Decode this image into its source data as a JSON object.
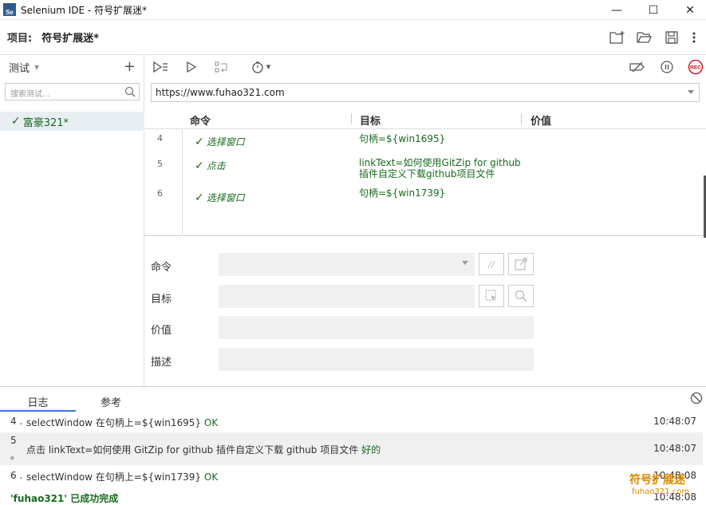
{
  "window": {
    "title": "Selenium IDE - 符号扩展迷*",
    "icon_text": "Se",
    "minimize": "—",
    "maximize": "☐",
    "close": "✕"
  },
  "project": {
    "label": "项目:",
    "name": "符号扩展迷*"
  },
  "sidebar": {
    "header": "测试",
    "add": "+",
    "search_placeholder": "搜索测试...",
    "tests": [
      {
        "name": "富豪321*",
        "status": "✓"
      }
    ]
  },
  "toolbar": {
    "url": "https://www.fuhao321.com"
  },
  "grid": {
    "headers": {
      "command": "命令",
      "target": "目标",
      "value": "价值"
    },
    "rows": [
      {
        "num": "4",
        "check": "✓",
        "command": "选择窗口",
        "target": "句柄=${win1695}",
        "target2": ""
      },
      {
        "num": "5",
        "check": "✓",
        "command": "点击",
        "target": "linkText=如何使用GitZip for github",
        "target2": "插件自定义下载github项目文件"
      },
      {
        "num": "6",
        "check": "✓",
        "command": "选择窗口",
        "target": "句柄=${win1739}",
        "target2": ""
      }
    ]
  },
  "editor": {
    "command_label": "命令",
    "target_label": "目标",
    "value_label": "价值",
    "description_label": "描述",
    "comment_btn": "//"
  },
  "logs": {
    "tab_log": "日志",
    "tab_reference": "参考",
    "entries": [
      {
        "prefix": "4 .",
        "text": "selectWindow 在句柄上=${win1695}",
        "status": "OK",
        "time": "10:48:07"
      },
      {
        "prefix": "5",
        "prefix2": "。",
        "text": "点击 linkText=如何使用 GitZip for github 插件自定义下载 github 项目文件",
        "status": "好的",
        "time": "10:48:07"
      },
      {
        "prefix": "6 .",
        "text": "selectWindow 在句柄上=${win1739}",
        "status": "OK",
        "time": "10:48:08"
      }
    ],
    "final": {
      "text": "'fuhao321' 已成功完成",
      "time": "10:48:08"
    }
  },
  "watermark": {
    "line1": "符号扩展迷",
    "line2": "fuhao321.com"
  },
  "colors": {
    "pass": "#196a1f",
    "accent": "#3a7bd5",
    "rec": "#d0021b"
  }
}
